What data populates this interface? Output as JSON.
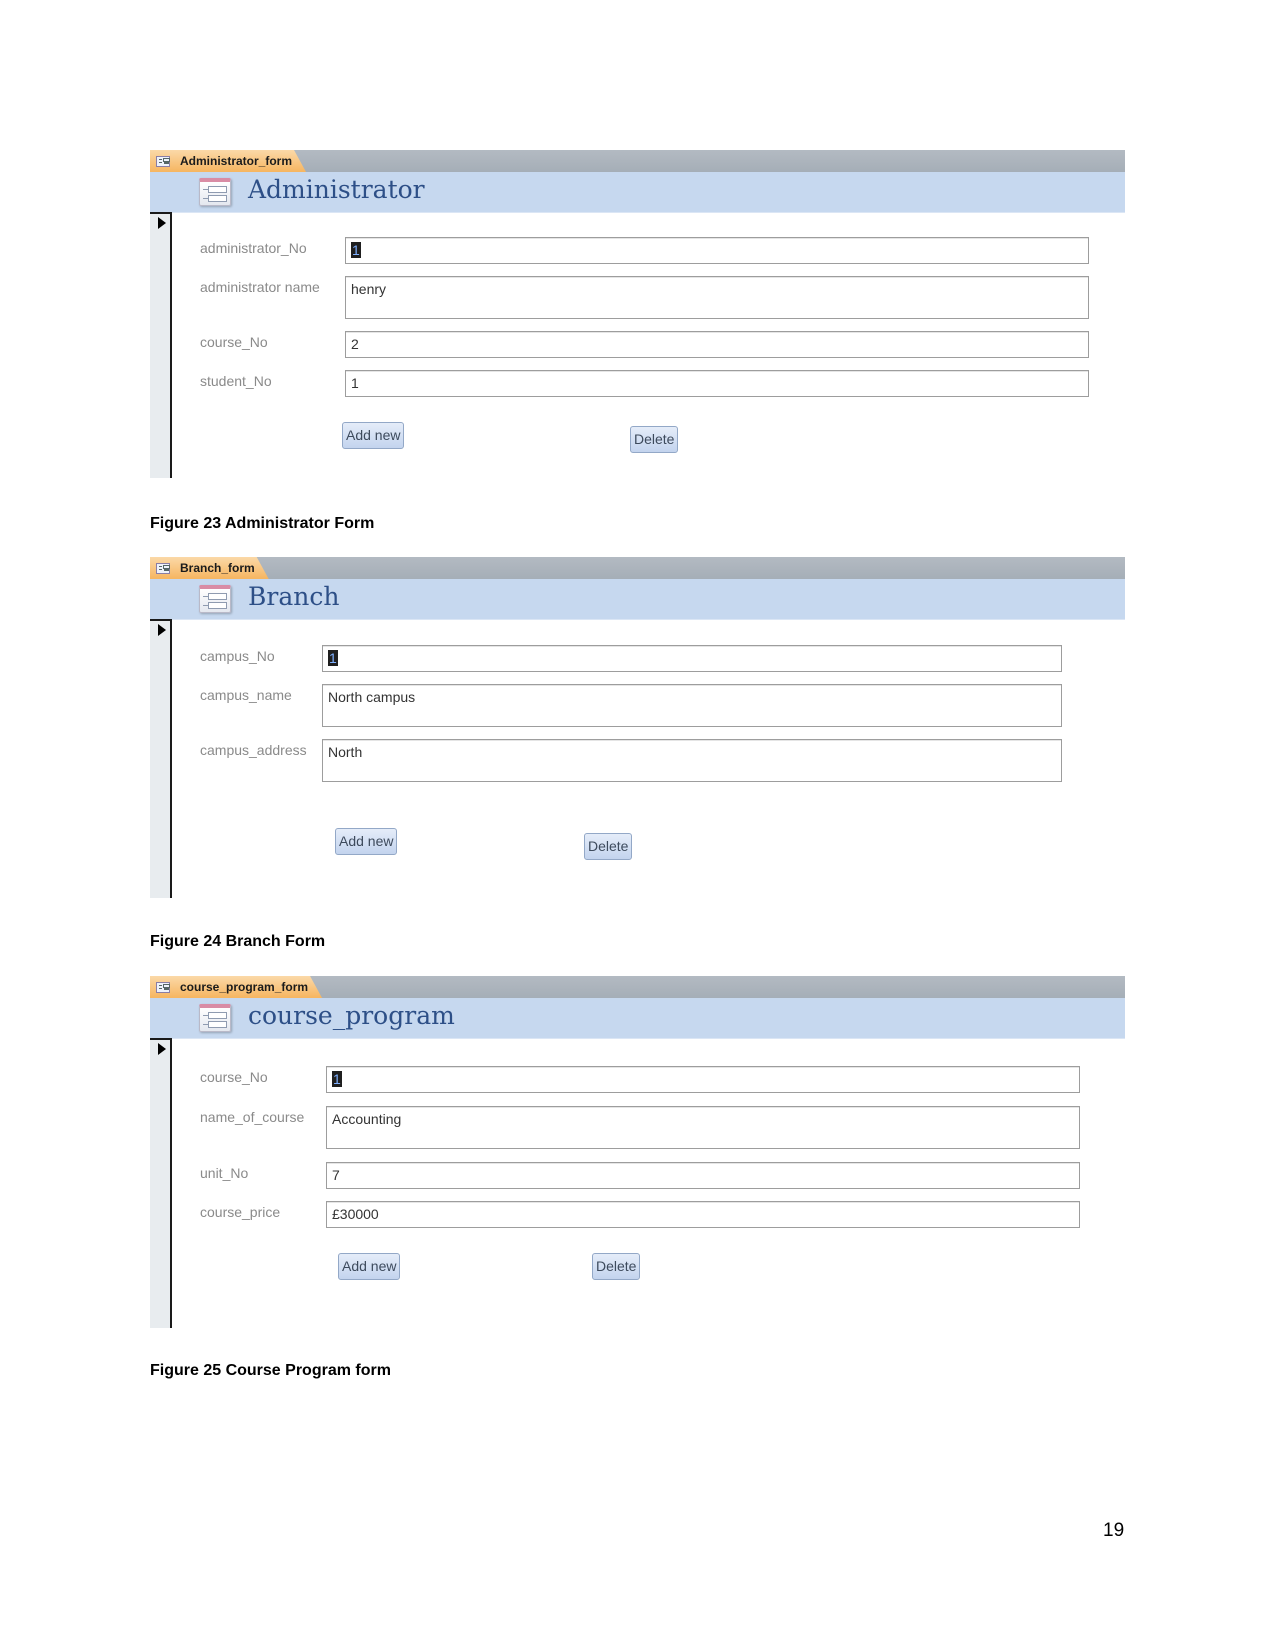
{
  "forms": [
    {
      "tab_label": "Administrator_form",
      "title": "Administrator",
      "fields": [
        {
          "label": "administrator_No",
          "value": "1",
          "selected": true
        },
        {
          "label": "administrator name",
          "value": "henry"
        },
        {
          "label": "course_No",
          "value": "2"
        },
        {
          "label": "student_No",
          "value": "1"
        }
      ],
      "buttons": {
        "add_new": "Add new",
        "delete": "Delete"
      },
      "caption": "Figure 23 Administrator Form"
    },
    {
      "tab_label": "Branch_form",
      "title": "Branch",
      "fields": [
        {
          "label": "campus_No",
          "value": "1",
          "selected": true
        },
        {
          "label": "campus_name",
          "value": "North campus"
        },
        {
          "label": "campus_address",
          "value": "North"
        }
      ],
      "buttons": {
        "add_new": "Add new",
        "delete": "Delete"
      },
      "caption": "Figure 24 Branch Form"
    },
    {
      "tab_label": "course_program_form",
      "title": "course_program",
      "fields": [
        {
          "label": "course_No",
          "value": "1",
          "selected": true
        },
        {
          "label": "name_of_course",
          "value": "Accounting"
        },
        {
          "label": "unit_No",
          "value": "7"
        },
        {
          "label": "course_price",
          "value": "£30000"
        }
      ],
      "buttons": {
        "add_new": "Add new",
        "delete": "Delete"
      },
      "caption": "Figure 25 Course Program form"
    }
  ],
  "page_number": "19"
}
